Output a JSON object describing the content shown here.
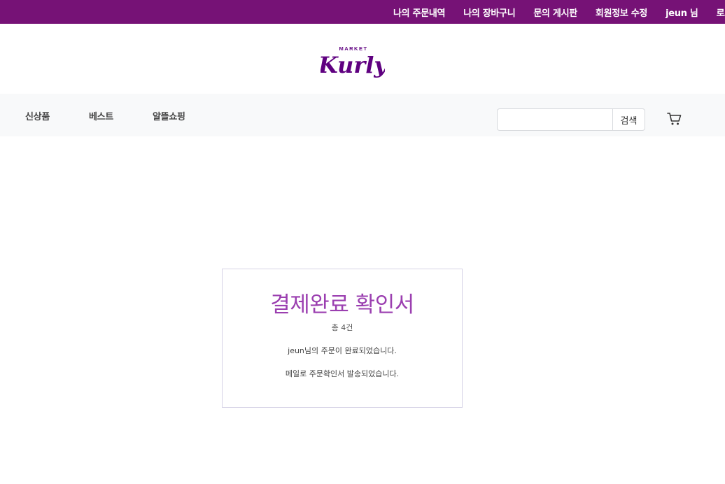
{
  "topbar": {
    "links": [
      "나의 주문내역",
      "나의 장바구니",
      "문의 게시판",
      "회원정보 수정",
      "jeun 님",
      "로그아웃"
    ]
  },
  "logo": {
    "top_text": "MARKET",
    "main_text": "Kurly"
  },
  "nav": {
    "items": [
      "신상품",
      "베스트",
      "알뜰쇼핑"
    ],
    "search_value": "",
    "search_button": "검색"
  },
  "confirmation": {
    "title": "결제완료 확인서",
    "count": "총 4건",
    "message1": "jeun님의 주문이 완료되었습니다.",
    "message2": "메일로 주문확인서 발송되었습니다."
  },
  "colors": {
    "brand": "#761276",
    "title": "#9b3fb0"
  },
  "icons": {
    "cart": "cart-icon"
  }
}
